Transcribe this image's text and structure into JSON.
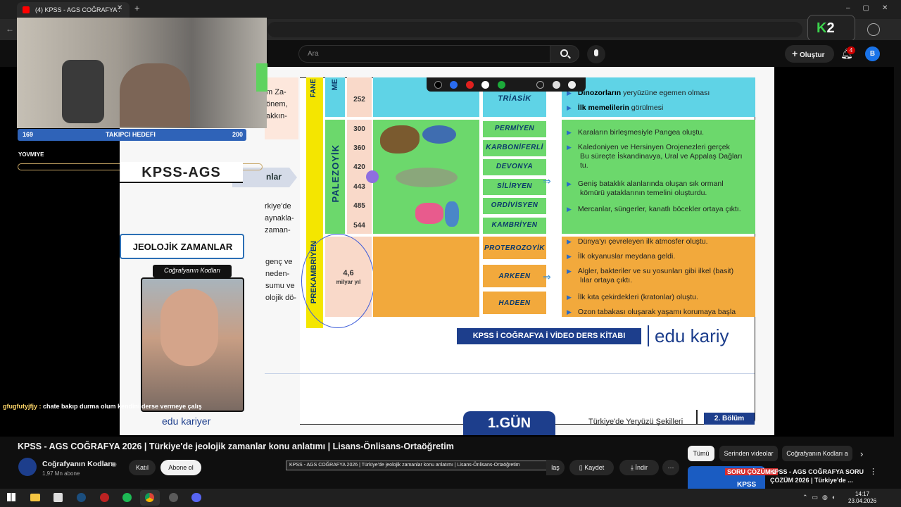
{
  "browser": {
    "tab_title": "(4) KPSS - AGS COĞRAFYA :",
    "new_tab": "+",
    "profile_initial": "B",
    "ext_badge": "2"
  },
  "youtube": {
    "search_placeholder": "Ara",
    "create_label": "Oluştur",
    "notif_count": "4",
    "avatar_initial": "B"
  },
  "stream": {
    "goal_left": "169",
    "goal_label": "TAKIPCI HEDEFI",
    "goal_right": "200",
    "yovmiye": "YOVMIYE",
    "kpss_ags": "KPSS-AGS",
    "jeolojik": "JEOLOJİK ZAMANLAR",
    "cografyanin_kodlari": "Coğrafyanın Kodları",
    "edu_logo": "edu kariyer",
    "chat_user": "gfugfutyjfjy :",
    "chat_msg": "chate bakıp durma olum kendini derse vermeye çalış"
  },
  "left_text": {
    "l1": "m Za-",
    "l2": "önem,",
    "l3": "akkın-",
    "l4": "nlar",
    "l5": "rkiye'de",
    "l6": "aynakla-",
    "l7": "zaman-",
    "l8": "genç ve",
    "l9": "neden-",
    "l10": "sumu ve",
    "l11": "olojik dö-"
  },
  "slide": {
    "fan": "FANE",
    "mes": "ME",
    "triasik_num": "252",
    "triasik": "TRİASİK",
    "pale": "PALEZOYİK",
    "prek": "PREKAMBRİYEN",
    "p_nums": [
      "300",
      "360",
      "420",
      "443",
      "485",
      "544"
    ],
    "p_eras": [
      "PERMİYEN",
      "KARBONİFERLİ",
      "DEVONYA",
      "SİLİRYEN",
      "ORDİVİSYEN",
      "KAMBRİYEN"
    ],
    "prek_num": "4,6",
    "prek_unit": "milyar yıl",
    "prek_eras": [
      "PROTEROZOYİK",
      "ARKEEN",
      "HADEEN"
    ],
    "top_events": [
      {
        "b": "Dinozorların",
        "t": " yeryüzüne egemen olması"
      },
      {
        "b": "İlk memelilerin",
        "t": " görülmesi"
      }
    ],
    "pale_events": [
      "Karaların birleşmesiyle Pangea oluştu.",
      "Kaledoniyen ve Hersinyen Orojenezleri gerçek",
      "Bu süreçte İskandinavya, Ural ve Appalaş Dağları",
      "tu.",
      "Geniş bataklık alanlarında oluşan sık ormanl",
      "kömürü yataklarının temelini oluşturdu.",
      "Mercanlar, süngerler, kanatlı böcekler ortaya çıktı."
    ],
    "prek_events": [
      "Dünya'yı çevreleyen ilk atmosfer oluştu.",
      "İlk okyanuslar meydana geldi.",
      "Alg­ler, bakteriler ve su yosunları gibi ilkel (basit)",
      "lılar ortaya çıktı.",
      "İlk kıta çekirdekleri (kratonlar) oluştu.",
      "Ozon tabakası oluşarak yaşamı korumaya başla"
    ],
    "banner": "KPSS İ COĞRAFYA İ VİDEO DERS KİTABI",
    "edu_brand": "edu kariy",
    "day": "1.GÜN",
    "footer_section": "Türkiye'de Yeryüzü Şekilleri",
    "footer_part": "2. Bölüm"
  },
  "video": {
    "title": "KPSS - AGS COĞRAFYA 2026 | Türkiye'de jeolojik zamanlar konu anlatımı | Lisans-Önlisans-Ortaöğretim",
    "tooltip": "KPSS - AGS COĞRAFYA 2026 | Türkiye'de jeolojik zamanlar konu anlatımı | Lisans-Önlisans-Ortaöğretim",
    "channel": "Coğrafyanın Kodları",
    "subs": "1,97 Mn abone",
    "join": "Katıl",
    "subscribe": "Abone ol",
    "share": "laş",
    "save": "Kaydet",
    "download": "İndir"
  },
  "sidebar": {
    "chips": [
      "Tümü",
      "Serinden videolar",
      "Coğrafyanın Kodları a"
    ],
    "rec_title_1": "KPSS - AGS COĞRAFYA SORU",
    "rec_title_2": "ÇÖZÜM 2026 | Türkiye'de ...",
    "thumb_text": "SORU ÇÖZÜM 1",
    "thumb_sub": "KPSS"
  },
  "taskbar": {
    "time": "14:17",
    "date": "23.04.2026"
  }
}
